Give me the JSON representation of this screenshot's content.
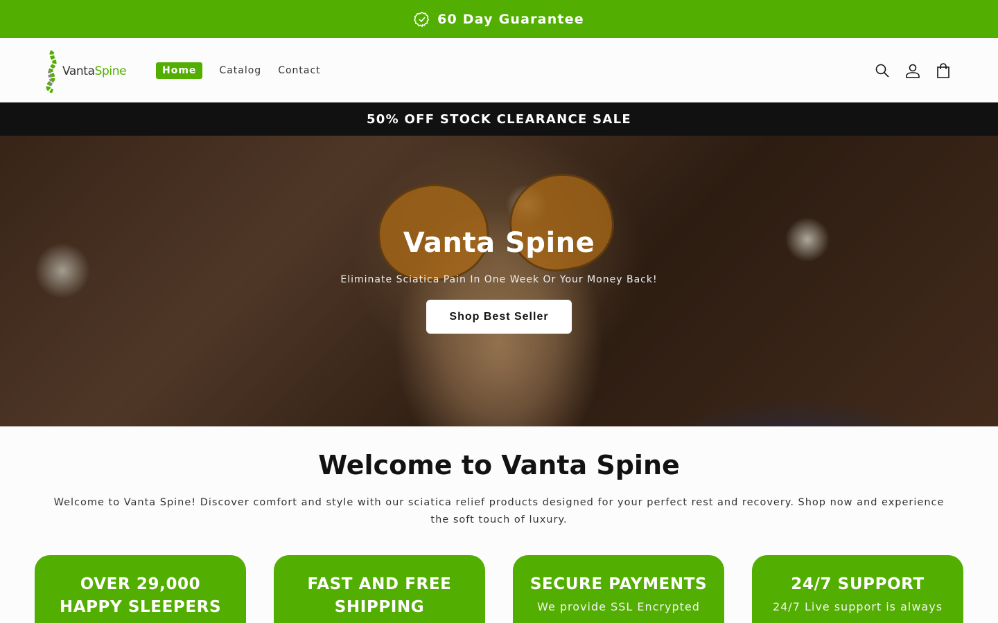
{
  "top_banner": {
    "text": "60 Day Guarantee",
    "icon": "verified-badge-icon"
  },
  "header": {
    "logo": {
      "vanta": "Vanta",
      "spine": "Spine"
    },
    "nav": [
      {
        "label": "Home",
        "active": true
      },
      {
        "label": "Catalog",
        "active": false
      },
      {
        "label": "Contact",
        "active": false
      }
    ],
    "icons": [
      "search-icon",
      "account-icon",
      "cart-icon"
    ]
  },
  "sale_bar": {
    "text": "50% OFF STOCK CLEARANCE SALE"
  },
  "hero": {
    "title": "Vanta Spine",
    "subtitle": "Eliminate Sciatica Pain In One Week Or Your Money Back!",
    "button": "Shop Best Seller"
  },
  "welcome": {
    "title": "Welcome to Vanta Spine",
    "text": "Welcome to Vanta Spine! Discover comfort and style with our sciatica relief products designed for your perfect rest and recovery. Shop now and experience the soft touch of luxury."
  },
  "features": [
    {
      "title": "OVER 29,000 HAPPY SLEEPERS",
      "text": ""
    },
    {
      "title": "FAST AND FREE SHIPPING",
      "text": ""
    },
    {
      "title": "SECURE PAYMENTS",
      "text": "We provide SSL Encrypted"
    },
    {
      "title": "24/7 SUPPORT",
      "text": "24/7 Live support is always"
    }
  ],
  "colors": {
    "brand_green": "#52ae00",
    "dark_bar": "#111111",
    "text": "#121212"
  }
}
